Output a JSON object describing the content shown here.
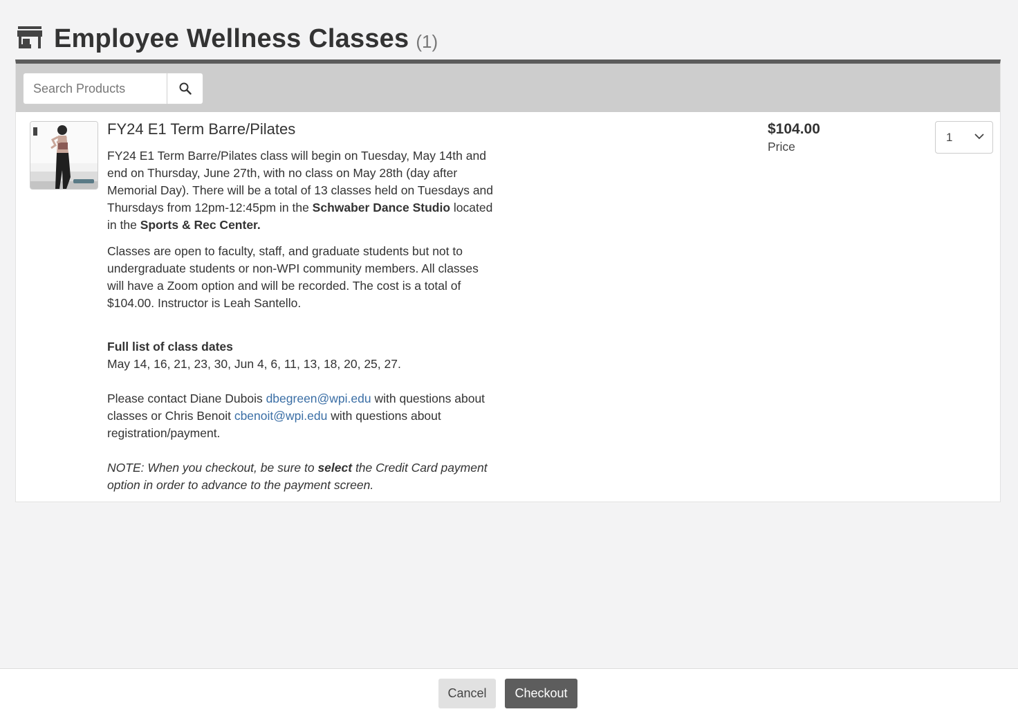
{
  "header": {
    "icon": "store-icon",
    "title": "Employee Wellness Classes",
    "count": "(1)"
  },
  "search": {
    "placeholder": "Search Products",
    "icon": "search-icon"
  },
  "product": {
    "image": "product-thumbnail",
    "title": "FY24 E1 Term Barre/Pilates",
    "para1": {
      "t1": "FY24 E1 Term Barre/Pilates class will begin on Tuesday, May 14th and end on Thursday, June 27th, with no class on May 28th (day after Memorial Day). There will be a total of 13 classes held on Tuesdays and Thursdays from 12pm-12:45pm in the ",
      "b1": "Schwaber Dance Studio",
      "t2": " located in the ",
      "b2": "Sports & Rec Center."
    },
    "para2": "Classes are open to faculty, staff, and graduate students but not to undergraduate students or non-WPI community members. All classes will have a Zoom option and will be recorded. The cost is a total of $104.00. Instructor is Leah Santello.",
    "dates_heading": "Full list of class dates",
    "dates": "May 14, 16, 21, 23, 30, Jun 4, 6, 11, 13, 18, 20, 25, 27.",
    "contact": {
      "t1": "Please contact Diane Dubois ",
      "email1": "dbegreen@wpi.edu",
      "t2": " with questions about classes or Chris Benoit ",
      "email2": "cbenoit@wpi.edu",
      "t3": " with questions about registration/payment."
    },
    "note": {
      "t1": "NOTE: When you checkout, be sure to ",
      "b1": "select",
      "t2": " the Credit Card payment option in order to advance to the payment screen."
    },
    "price": "$104.00",
    "price_label": "Price",
    "quantity": "1"
  },
  "footer": {
    "cancel_label": "Cancel",
    "checkout_label": "Checkout"
  }
}
